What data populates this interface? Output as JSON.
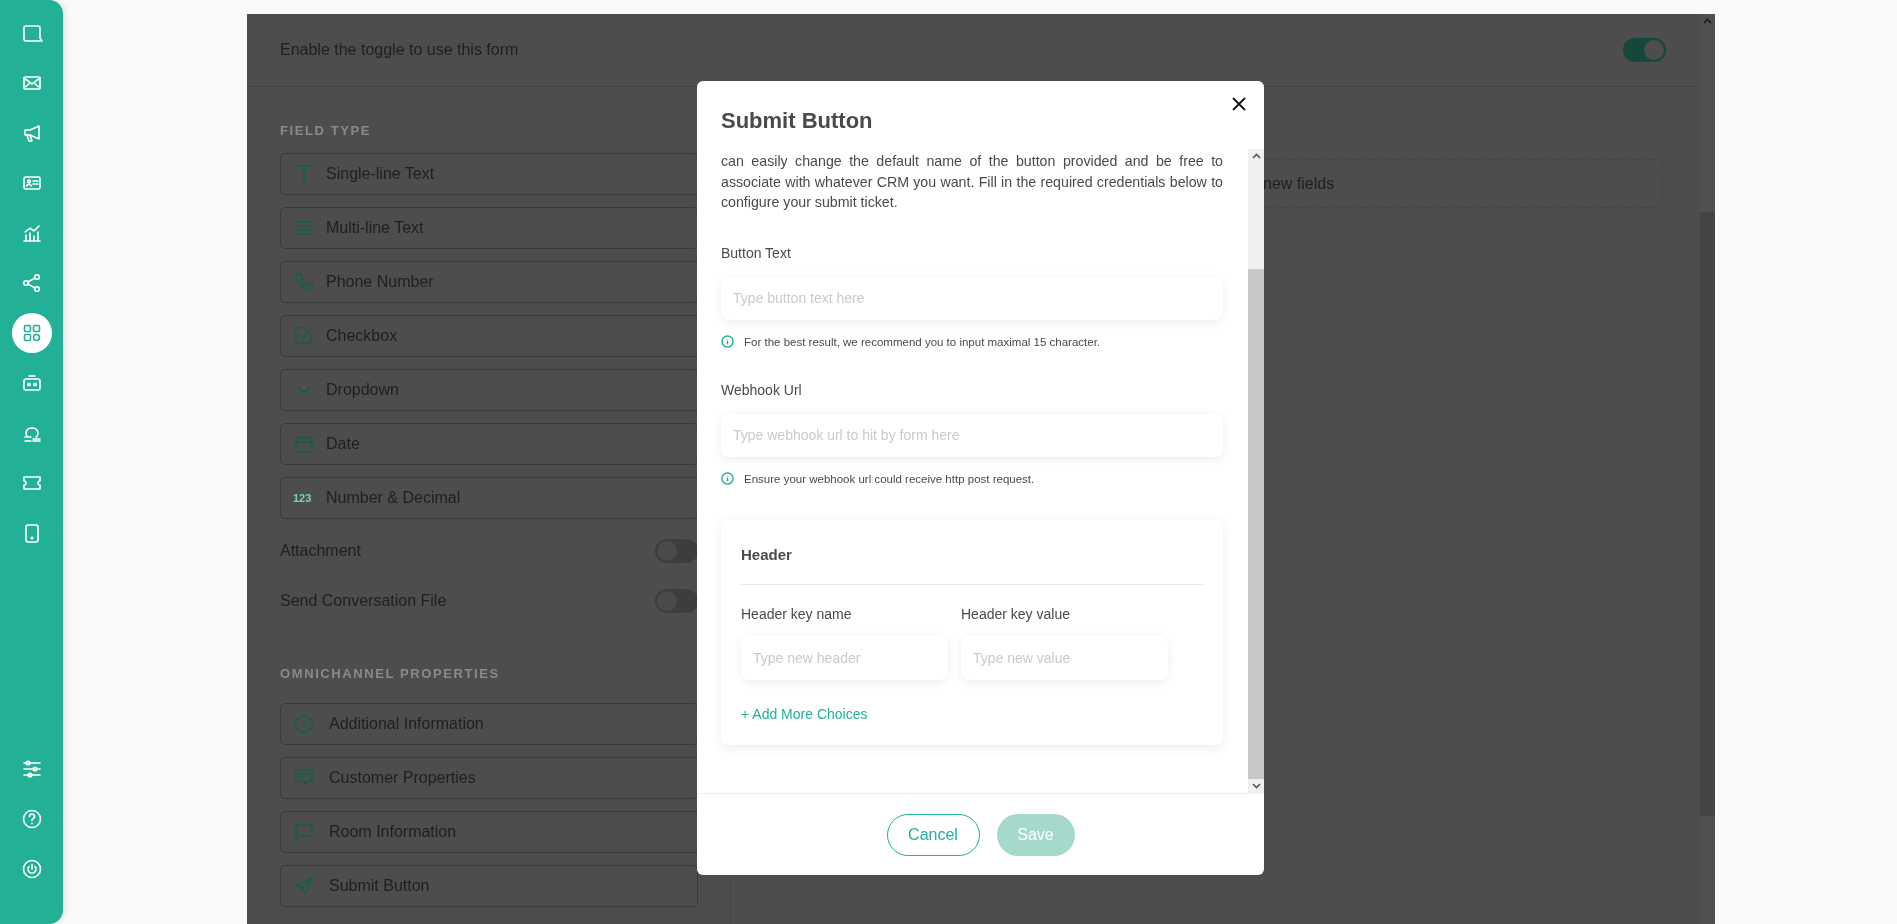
{
  "sidebar": {
    "items": [
      {
        "selected": false
      },
      {
        "selected": false
      },
      {
        "selected": false
      },
      {
        "selected": false
      },
      {
        "selected": false
      },
      {
        "selected": false
      },
      {
        "selected": true
      },
      {
        "selected": false
      },
      {
        "selected": false
      },
      {
        "selected": false
      },
      {
        "selected": false
      }
    ]
  },
  "form_toggle": {
    "label": "Enable the toggle to use this form",
    "on": true
  },
  "field_type": {
    "heading": "FIELD TYPE",
    "items": [
      {
        "label": "Single-line Text"
      },
      {
        "label": "Multi-line Text"
      },
      {
        "label": "Phone Number"
      },
      {
        "label": "Checkbox"
      },
      {
        "label": "Dropdown"
      },
      {
        "label": "Date"
      },
      {
        "label": "Number & Decimal",
        "icon_text": "123"
      }
    ]
  },
  "switches": [
    {
      "label": "Attachment",
      "on": false
    },
    {
      "label": "Send Conversation File",
      "on": false
    }
  ],
  "omnichannel": {
    "heading": "OMNICHANNEL PROPERTIES",
    "items": [
      {
        "label": "Additional Information"
      },
      {
        "label": "Customer Properties"
      },
      {
        "label": "Room Information"
      },
      {
        "label": "Submit Button"
      }
    ]
  },
  "canvas": {
    "hint": "new fields"
  },
  "modal": {
    "title": "Submit Button",
    "description": "can easily change the default name of the button provided and be free to associate with whatever CRM you want. Fill in the required credentials below to configure your submit ticket.",
    "fields": [
      {
        "label": "Button Text",
        "placeholder": "Type button text here",
        "hint": "For the best result, we recommend you to input maximal 15 character."
      },
      {
        "label": "Webhook Url",
        "placeholder": "Type webhook url to hit by form here",
        "hint": "Ensure your webhook url could receive http post request."
      }
    ],
    "header_card": {
      "title": "Header",
      "columns": [
        {
          "label": "Header key name",
          "placeholder": "Type new header"
        },
        {
          "label": "Header key value",
          "placeholder": "Type new value"
        }
      ],
      "add_link": "+ Add More Choices"
    },
    "buttons": [
      {
        "label": "Cancel",
        "kind": "secondary",
        "disabled": false
      },
      {
        "label": "Save",
        "kind": "primary",
        "disabled": true
      }
    ]
  }
}
